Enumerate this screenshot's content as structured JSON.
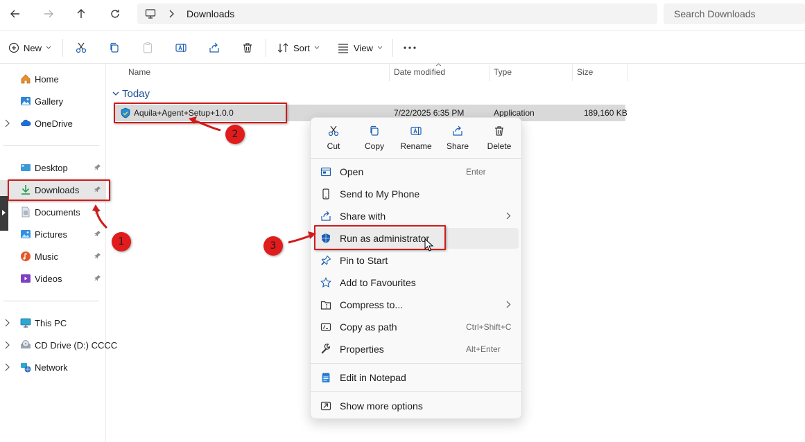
{
  "address_bar": {
    "path": "Downloads",
    "search_placeholder": "Search Downloads"
  },
  "command_bar": {
    "new_label": "New",
    "sort_label": "Sort",
    "view_label": "View"
  },
  "sidebar": {
    "items": [
      {
        "label": "Home"
      },
      {
        "label": "Gallery"
      },
      {
        "label": "OneDrive"
      },
      {
        "label": "Desktop"
      },
      {
        "label": "Downloads"
      },
      {
        "label": "Documents"
      },
      {
        "label": "Pictures"
      },
      {
        "label": "Music"
      },
      {
        "label": "Videos"
      },
      {
        "label": "This PC"
      },
      {
        "label": "CD Drive (D:) CCCC"
      },
      {
        "label": "Network"
      }
    ]
  },
  "file_list": {
    "columns": [
      "Name",
      "Date modified",
      "Type",
      "Size"
    ],
    "group": "Today",
    "files": [
      {
        "name": "Aquila+Agent+Setup+1.0.0",
        "date": "7/22/2025 6:35 PM",
        "type": "Application",
        "size": "189,160 KB"
      }
    ]
  },
  "context_menu": {
    "quick_actions": [
      "Cut",
      "Copy",
      "Rename",
      "Share",
      "Delete"
    ],
    "items": [
      {
        "label": "Open",
        "shortcut": "Enter"
      },
      {
        "label": "Send to My Phone",
        "shortcut": ""
      },
      {
        "label": "Share with",
        "shortcut": ""
      },
      {
        "label": "Run as administrator",
        "shortcut": ""
      },
      {
        "label": "Pin to Start",
        "shortcut": ""
      },
      {
        "label": "Add to Favourites",
        "shortcut": ""
      },
      {
        "label": "Compress to...",
        "shortcut": ""
      },
      {
        "label": "Copy as path",
        "shortcut": "Ctrl+Shift+C"
      },
      {
        "label": "Properties",
        "shortcut": "Alt+Enter"
      },
      {
        "label": "Edit in Notepad",
        "shortcut": ""
      },
      {
        "label": "Show more options",
        "shortcut": ""
      }
    ]
  },
  "annotations": {
    "step1": "1",
    "step2": "2",
    "step3": "3",
    "color": "#d11a1a"
  },
  "colors": {
    "accent": "#0067c0",
    "highlight_box": "#d11a1a",
    "group_header": "#1d4f91"
  }
}
